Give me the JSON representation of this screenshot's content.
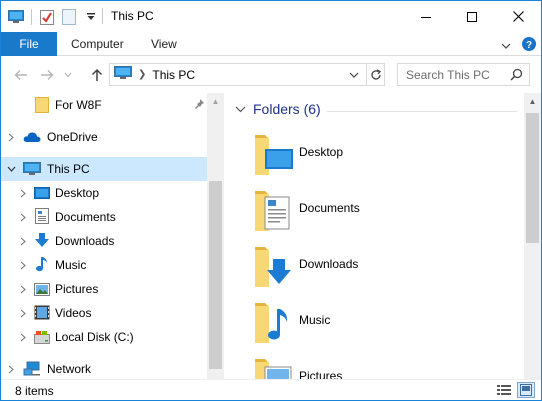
{
  "window": {
    "title": "This PC"
  },
  "quick_access_toolbar": {
    "icons": [
      "this-pc-icon",
      "properties-icon",
      "new-folder-icon",
      "customize-dropdown-icon"
    ]
  },
  "ribbon": {
    "tabs": [
      {
        "label": "File",
        "active": true
      },
      {
        "label": "Computer"
      },
      {
        "label": "View"
      }
    ]
  },
  "address_bar": {
    "location_icon": "this-pc-icon",
    "breadcrumb": "This PC"
  },
  "search": {
    "placeholder": "Search This PC"
  },
  "navigation": {
    "items": [
      {
        "label": "For W8F",
        "icon": "folder-icon",
        "pinned": true
      },
      {
        "label": "OneDrive",
        "icon": "onedrive-icon",
        "expandable": true
      },
      {
        "label": "This PC",
        "icon": "this-pc-icon",
        "expanded": true,
        "selected": true
      },
      {
        "label": "Desktop",
        "icon": "desktop-icon",
        "expandable": true
      },
      {
        "label": "Documents",
        "icon": "documents-icon",
        "expandable": true
      },
      {
        "label": "Downloads",
        "icon": "downloads-icon",
        "expandable": true
      },
      {
        "label": "Music",
        "icon": "music-icon",
        "expandable": true
      },
      {
        "label": "Pictures",
        "icon": "pictures-icon",
        "expandable": true
      },
      {
        "label": "Videos",
        "icon": "videos-icon",
        "expandable": true
      },
      {
        "label": "Local Disk (C:)",
        "icon": "local-disk-icon",
        "expandable": true
      },
      {
        "label": "Network",
        "icon": "network-icon",
        "expandable": true
      }
    ]
  },
  "content": {
    "group_title": "Folders (6)",
    "folders": [
      {
        "label": "Desktop",
        "overlay": "desktop"
      },
      {
        "label": "Documents",
        "overlay": "documents"
      },
      {
        "label": "Downloads",
        "overlay": "downloads"
      },
      {
        "label": "Music",
        "overlay": "music"
      },
      {
        "label": "Pictures",
        "overlay": "pictures"
      }
    ]
  },
  "status_bar": {
    "item_count": "8 items"
  },
  "colors": {
    "accent": "#1979ca",
    "selection": "#cce8ff",
    "group_title": "#1e3287",
    "folder_yellow": "#f8d775",
    "folder_dark": "#e8b43c"
  }
}
